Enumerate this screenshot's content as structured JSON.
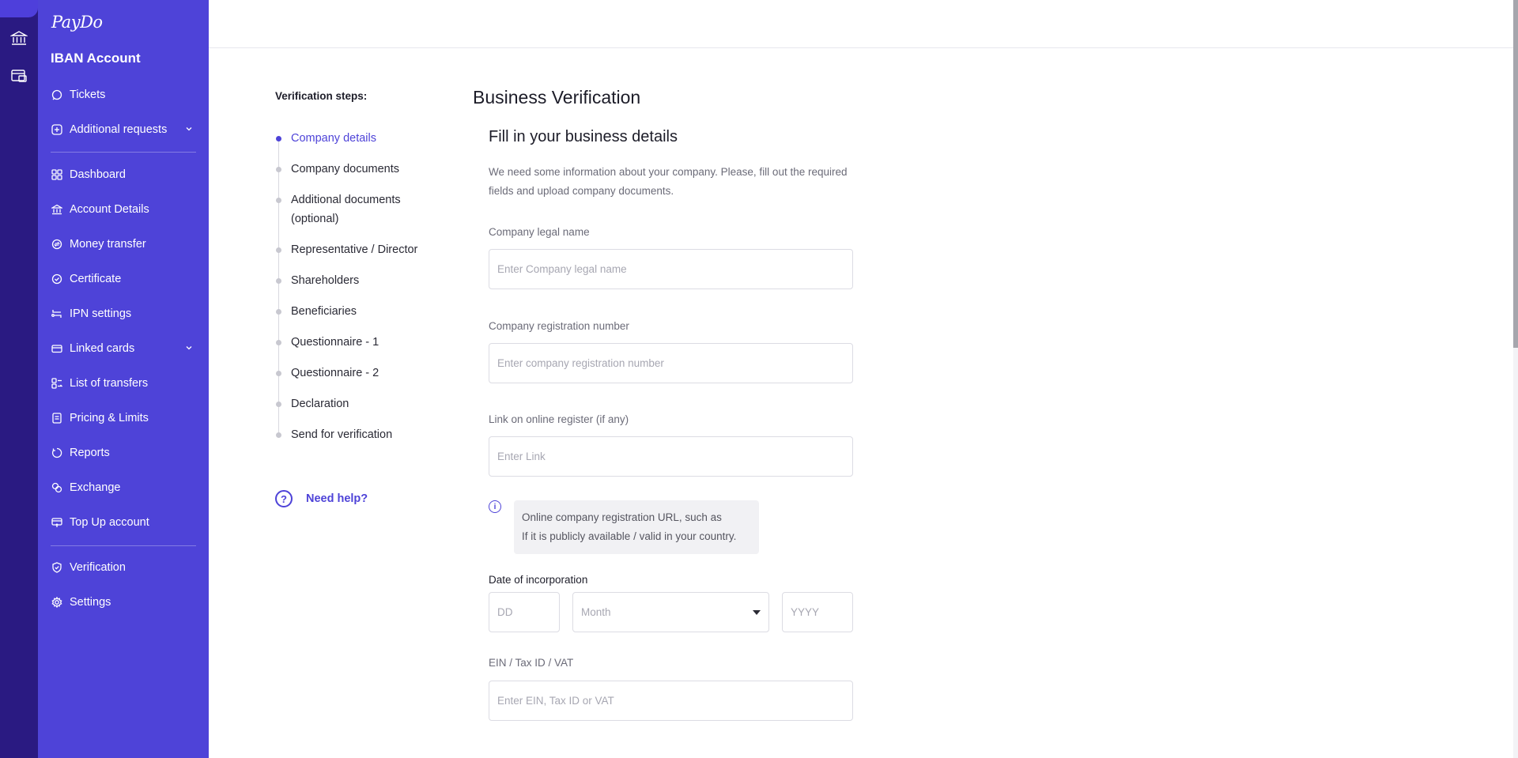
{
  "brand": {
    "logo": "PayDo",
    "accent": "#4e43d8",
    "rail_color": "#2a1a82"
  },
  "rail": {
    "icons": [
      "bank-icon",
      "wallet-card-icon"
    ]
  },
  "sidebar": {
    "account_title": "IBAN Account",
    "top_items": [
      {
        "label": "Tickets",
        "icon": "chat-bubble-icon"
      },
      {
        "label": "Additional requests",
        "icon": "plus-square-icon",
        "has_chevron": true
      }
    ],
    "main_items": [
      {
        "label": "Dashboard",
        "icon": "grid-icon"
      },
      {
        "label": "Account Details",
        "icon": "bank-icon"
      },
      {
        "label": "Money transfer",
        "icon": "exchange-circle-icon"
      },
      {
        "label": "Certificate",
        "icon": "check-circle-icon"
      },
      {
        "label": "IPN settings",
        "icon": "ipn-icon"
      },
      {
        "label": "Linked cards",
        "icon": "card-icon",
        "has_chevron": true
      },
      {
        "label": "List of transfers",
        "icon": "list-transfers-icon"
      },
      {
        "label": "Pricing & Limits",
        "icon": "document-icon"
      },
      {
        "label": "Reports",
        "icon": "reports-icon"
      },
      {
        "label": "Exchange",
        "icon": "exchange-icon"
      },
      {
        "label": "Top Up account",
        "icon": "top-up-icon"
      }
    ],
    "bottom_items": [
      {
        "label": "Verification",
        "icon": "shield-check-icon"
      },
      {
        "label": "Settings",
        "icon": "gear-icon"
      }
    ]
  },
  "steps": {
    "title": "Verification steps:",
    "items": [
      {
        "label": "Company details",
        "active": true
      },
      {
        "label": "Company documents"
      },
      {
        "label": "Additional documents (optional)"
      },
      {
        "label": "Representative / Director"
      },
      {
        "label": "Shareholders"
      },
      {
        "label": "Beneficiaries"
      },
      {
        "label": "Questionnaire - 1"
      },
      {
        "label": "Questionnaire - 2"
      },
      {
        "label": "Declaration"
      },
      {
        "label": "Send for verification"
      }
    ],
    "help": "Need help?"
  },
  "form": {
    "page_title": "Business Verification",
    "section_title": "Fill in your business details",
    "intro": "We need some information about your company. Please, fill out the required fields and upload company documents.",
    "legal_name": {
      "label": "Company legal name",
      "placeholder": "Enter Company legal name",
      "value": ""
    },
    "registration_number": {
      "label": "Company registration number",
      "placeholder": "Enter company registration number",
      "value": ""
    },
    "register_link": {
      "label": "Link on online register (if any)",
      "placeholder": "Enter Link",
      "value": ""
    },
    "register_info": {
      "line1": "Online company registration URL, such as",
      "line2": "If it is publicly available / valid in your country."
    },
    "date_of_incorporation": {
      "label": "Date of incorporation",
      "dd_placeholder": "DD",
      "month_placeholder": "Month",
      "yyyy_placeholder": "YYYY"
    },
    "tax_id": {
      "label": "EIN / Tax ID / VAT",
      "placeholder": "Enter EIN, Tax ID or VAT",
      "value": ""
    }
  }
}
